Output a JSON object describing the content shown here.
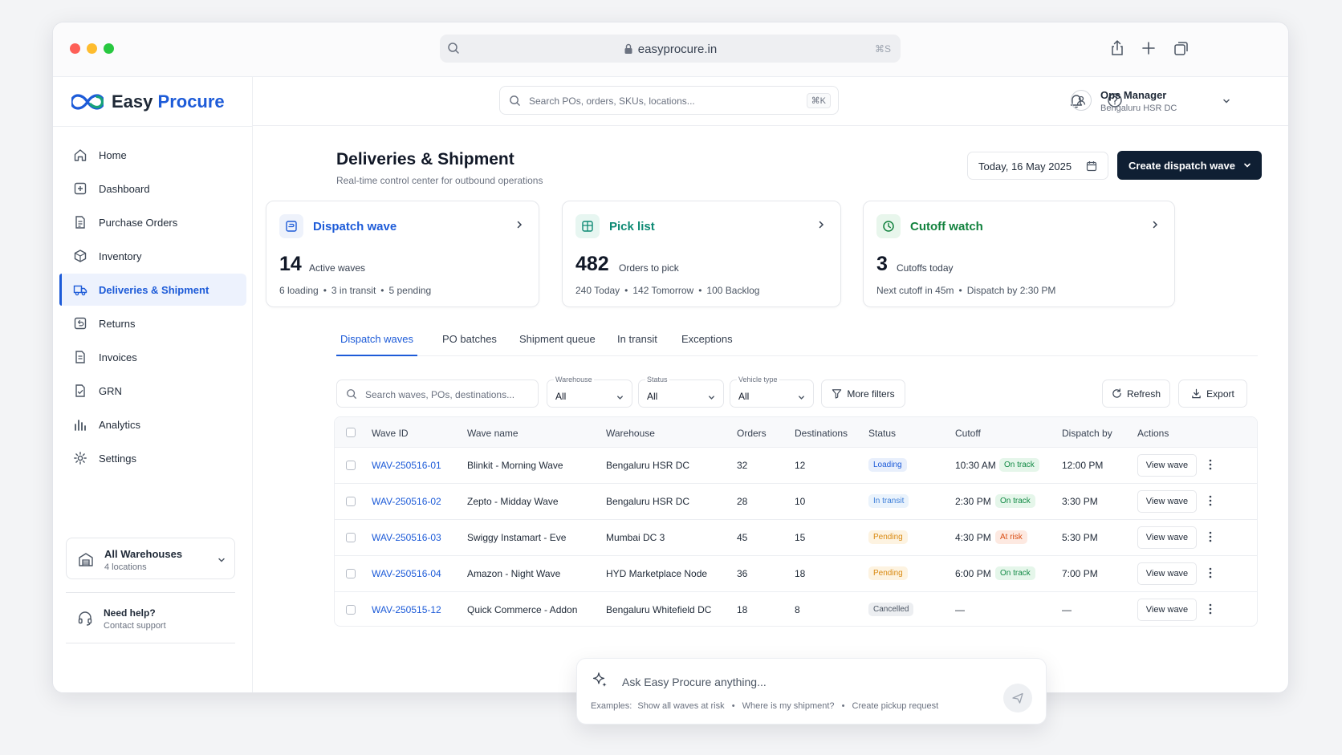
{
  "browser": {
    "url": "easyprocure.in",
    "shortcut": "⌘S"
  },
  "app": {
    "logo_name": "Easy",
    "logo_accent": "Procure"
  },
  "sidebar": {
    "items": [
      {
        "label": "Home",
        "icon": "home-icon",
        "active": false
      },
      {
        "label": "Dashboard",
        "icon": "dashboard-icon",
        "active": false
      },
      {
        "label": "Purchase Orders",
        "icon": "document-icon",
        "active": false
      },
      {
        "label": "Inventory",
        "icon": "box-icon",
        "active": false
      },
      {
        "label": "Deliveries & Shipment",
        "icon": "truck-icon",
        "active": true
      },
      {
        "label": "Returns",
        "icon": "return-icon",
        "active": false
      },
      {
        "label": "Invoices",
        "icon": "invoice-icon",
        "active": false
      },
      {
        "label": "GRN",
        "icon": "grn-icon",
        "active": false
      },
      {
        "label": "Analytics",
        "icon": "bar-chart-icon",
        "active": false
      },
      {
        "label": "Settings",
        "icon": "gear-icon",
        "active": false
      }
    ],
    "warehouse": {
      "title": "All Warehouses",
      "sub": "4 locations"
    },
    "help": {
      "title": "Need help?",
      "sub": "Contact support"
    }
  },
  "topbar": {
    "search_placeholder": "Search POs, orders, SKUs, locations...",
    "search_shortcut": "⌘K",
    "user_name": "Ops Manager",
    "user_location": "Bengaluru HSR DC"
  },
  "page": {
    "title": "Deliveries & Shipment",
    "subtitle": "Real-time control center for outbound operations",
    "date": "Today, 16 May 2025",
    "create_button": "Create dispatch wave"
  },
  "stats": [
    {
      "title": "Dispatch wave",
      "value": "14",
      "value_label": "Active waves",
      "details": [
        "6 loading",
        "3 in transit",
        "5 pending"
      ],
      "color": "#1d5bd8",
      "bg": "#eef2fb"
    },
    {
      "title": "Pick list",
      "value": "482",
      "value_label": "Orders to pick",
      "details": [
        "240 Today",
        "142 Tomorrow",
        "100 Backlog"
      ],
      "color": "#0e8a74",
      "bg": "#e7f6f1"
    },
    {
      "title": "Cutoff watch",
      "value": "3",
      "value_label": "Cutoffs today",
      "details": [
        "Next cutoff in 45m",
        "Dispatch by 2:30 PM"
      ],
      "color": "#12823e",
      "bg": "#e8f6ec"
    }
  ],
  "tabs": [
    "Dispatch waves",
    "PO batches",
    "Shipment queue",
    "In transit",
    "Exceptions"
  ],
  "filters": {
    "search_placeholder": "Search waves, POs, destinations...",
    "warehouse": {
      "label": "Warehouse",
      "value": "All"
    },
    "status": {
      "label": "Status",
      "value": "All"
    },
    "vehicle": {
      "label": "Vehicle type",
      "value": "All"
    },
    "more": "More filters",
    "refresh": "Refresh",
    "export": "Export"
  },
  "table": {
    "columns": [
      "Wave ID",
      "Wave name",
      "Warehouse",
      "Orders",
      "Destinations",
      "Status",
      "Cutoff",
      "Dispatch by",
      "Actions"
    ],
    "rows": [
      {
        "id": "WAV-250516-01",
        "name": "Blinkit - Morning Wave",
        "warehouse": "Bengaluru HSR DC",
        "orders": "32",
        "dest": "12",
        "status": "Loading",
        "cutoff": "10:30 AM",
        "risk": "On track",
        "dispatch": "12:00 PM",
        "action": "View wave"
      },
      {
        "id": "WAV-250516-02",
        "name": "Zepto - Midday Wave",
        "warehouse": "Bengaluru HSR DC",
        "orders": "28",
        "dest": "10",
        "status": "In transit",
        "cutoff": "2:30 PM",
        "risk": "On track",
        "dispatch": "3:30 PM",
        "action": "View wave"
      },
      {
        "id": "WAV-250516-03",
        "name": "Swiggy Instamart - Eve",
        "warehouse": "Mumbai DC 3",
        "orders": "45",
        "dest": "15",
        "status": "Pending",
        "cutoff": "4:30 PM",
        "risk": "At risk",
        "dispatch": "5:30 PM",
        "action": "View wave"
      },
      {
        "id": "WAV-250516-04",
        "name": "Amazon - Night Wave",
        "warehouse": "HYD Marketplace Node",
        "orders": "36",
        "dest": "18",
        "status": "Pending",
        "cutoff": "6:00 PM",
        "risk": "On track",
        "dispatch": "7:00 PM",
        "action": "View wave"
      },
      {
        "id": "WAV-250515-12",
        "name": "Quick Commerce - Addon",
        "warehouse": "Bengaluru Whitefield DC",
        "orders": "18",
        "dest": "8",
        "status": "Cancelled",
        "cutoff": "—",
        "risk": "",
        "dispatch": "—",
        "action": "View wave"
      }
    ]
  },
  "assistant": {
    "placeholder": "Ask Easy Procure anything...",
    "examples_label": "Examples:",
    "examples": [
      "Show all waves at risk",
      "Where is my shipment?",
      "Create pickup request"
    ]
  },
  "status_colors": {
    "Loading": {
      "fg": "#1d5bd8",
      "bg": "#e8effc"
    },
    "In transit": {
      "fg": "#3e7fd9",
      "bg": "#eaf3fc"
    },
    "Pending": {
      "fg": "#d98a12",
      "bg": "#fdf3e1"
    },
    "Cancelled": {
      "fg": "#4b5563",
      "bg": "#eceef1"
    },
    "On track": {
      "fg": "#128a45",
      "bg": "#e5f6ea"
    },
    "At risk": {
      "fg": "#d94c12",
      "bg": "#fde9e1"
    }
  }
}
